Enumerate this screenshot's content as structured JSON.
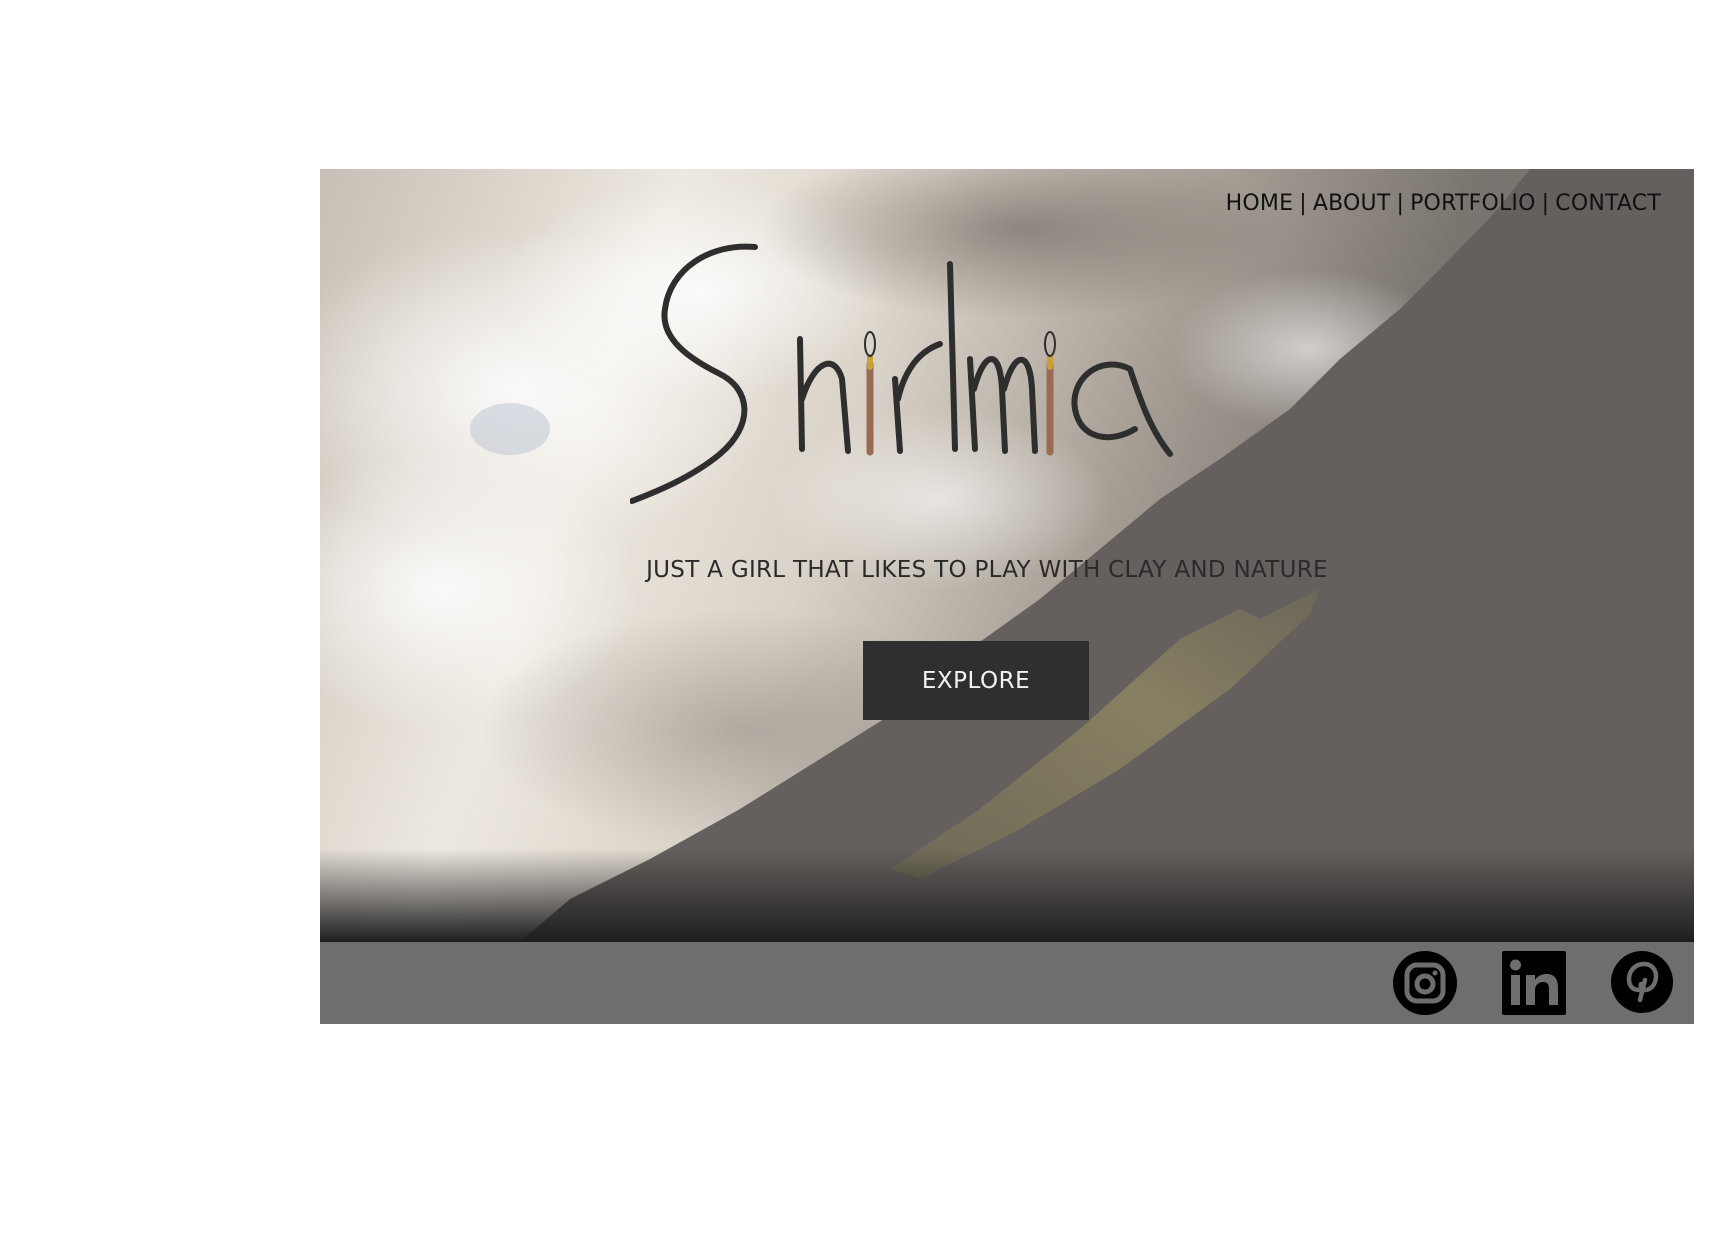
{
  "brand": {
    "logo_text": "Shirlmia"
  },
  "nav": {
    "items": [
      {
        "label": "HOME"
      },
      {
        "label": "ABOUT"
      },
      {
        "label": "PORTFOLIO"
      },
      {
        "label": "CONTACT"
      }
    ],
    "separator": "|"
  },
  "hero": {
    "tagline": "JUST A GIRL THAT LIKES TO PLAY WITH CLAY AND NATURE",
    "cta_label": "EXPLORE"
  },
  "social": {
    "icons": [
      "instagram-icon",
      "linkedin-icon",
      "pinterest-icon"
    ]
  },
  "colors": {
    "button_bg": "#2f2f2f",
    "footer_bg": "#6f6e6e",
    "overlay": "#65605d"
  }
}
